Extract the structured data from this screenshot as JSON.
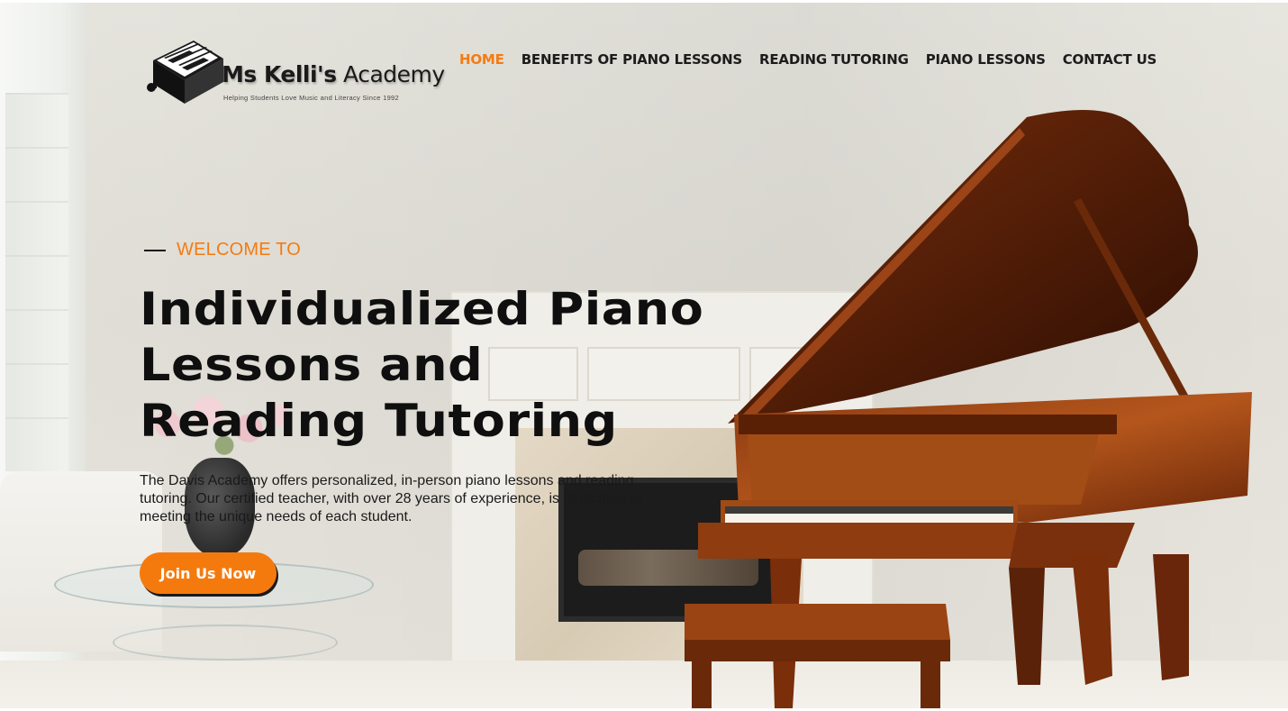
{
  "brand": {
    "name_bold": "Ms Kelli's",
    "name_regular": " Academy",
    "tagline": "Helping Students Love Music and Literacy Since 1992"
  },
  "nav": {
    "items": [
      {
        "label": "HOME",
        "active": true
      },
      {
        "label": "BENEFITS OF PIANO LESSONS",
        "active": false
      },
      {
        "label": "READING TUTORING",
        "active": false
      },
      {
        "label": "PIANO LESSONS",
        "active": false
      },
      {
        "label": "CONTACT US",
        "active": false
      }
    ]
  },
  "hero": {
    "eyebrow": "WELCOME TO",
    "headline_line1": "Individualized Piano",
    "headline_line2": "Lessons and",
    "headline_line3": "Reading Tutoring",
    "description": "The Davis Academy offers personalized, in-person piano lessons and reading tutoring. Our certified teacher, with over 28 years of experience, is dedicated to meeting the unique needs of each student.",
    "cta_label": "Join Us Now"
  },
  "colors": {
    "accent": "#f47b12",
    "text": "#1a1a1a",
    "button": "#f57a0e"
  },
  "icons": {
    "logo": "piano-box-logo-icon",
    "eyebrow_line": "dash-line-icon"
  }
}
